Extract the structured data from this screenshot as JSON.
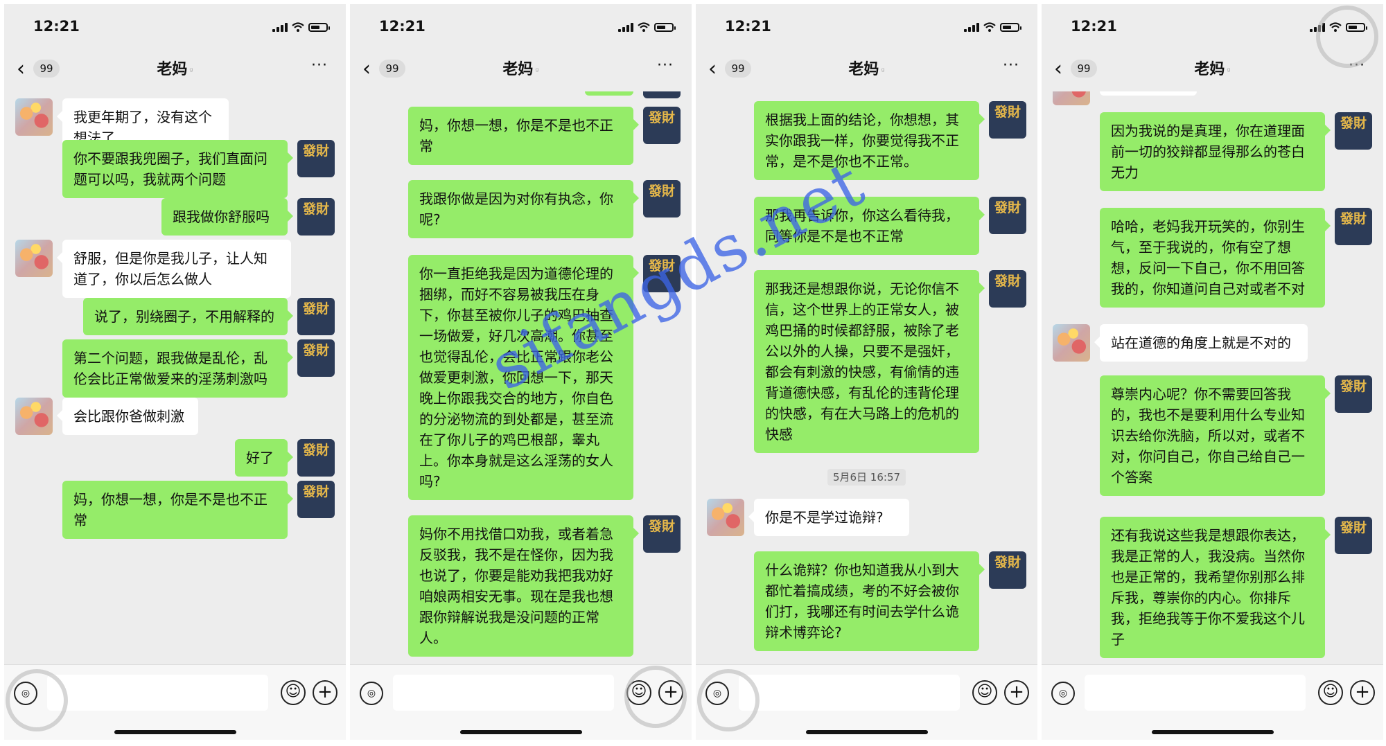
{
  "status": {
    "time": "12:21"
  },
  "nav": {
    "unread": "99",
    "title": "老妈",
    "more": "···",
    "back": "‹"
  },
  "avatar_label": "發財",
  "watermark": "sifangds.net",
  "panels": [
    {
      "messages": [
        {
          "side": "in",
          "text": "我更年期了，没有这个想法了"
        },
        {
          "side": "out",
          "text": "你不要跟我兜圈子，我们直面问题可以吗，我就两个问题"
        },
        {
          "side": "out",
          "text": "跟我做你舒服吗"
        },
        {
          "side": "in",
          "text": "舒服，但是你是我儿子，让人知道了，你以后怎么做人"
        },
        {
          "side": "out",
          "text": "说了，别绕圈子，不用解释的"
        },
        {
          "side": "out",
          "text": "第二个问题，跟我做是乱伦，乱伦会比正常做爱来的淫荡刺激吗"
        },
        {
          "side": "in",
          "text": "会比跟你爸做刺激"
        },
        {
          "side": "out",
          "text": "好了"
        },
        {
          "side": "out",
          "text": "妈，你想一想，你是不是也不正常"
        }
      ]
    },
    {
      "messages": [
        {
          "side": "out",
          "text": "妈，你想一想，你是不是也不正常"
        },
        {
          "side": "out",
          "text": "我跟你做是因为对你有执念，你呢?"
        },
        {
          "side": "out",
          "text": "你一直拒绝我是因为道德伦理的捆绑，而好不容易被我压在身下，你甚至被你儿子的鸡巴抽查一场做爱，好几次高潮。你甚至也觉得乱伦，会比正常跟你老公做爱更刺激，你回想一下，那天晚上你跟我交合的地方，你自色的分泌物流的到处都是，甚至流在了你儿子的鸡巴根部，睾丸上。你本身就是这么淫荡的女人吗?"
        },
        {
          "side": "out",
          "text": "妈你不用找借口劝我，或者着急反驳我，我不是在怪你，因为我也说了，你要是能劝我把我劝好咱娘两相安无事。现在是我也想跟你辩解说我是没问题的正常人。"
        }
      ]
    },
    {
      "messages": [
        {
          "side": "out",
          "text": "根据我上面的结论，你想想，其实你跟我一样，你要觉得我不正常，是不是你也不正常。"
        },
        {
          "side": "out",
          "text": "那我再告诉你，你这么看待我，同等你是不是也不正常"
        },
        {
          "side": "out",
          "text": "那我还是想跟你说，无论你信不信，这个世界上的正常女人，被鸡巴捅的时候都舒服，被除了老公以外的人操，只要不是强奸，都会有刺激的快感，有偷情的违背道德快感，有乱伦的违背伦理的快感，有在大马路上的危机的快感"
        },
        {
          "side": "time",
          "text": "5月6日 16:57"
        },
        {
          "side": "in",
          "text": "你是不是学过诡辩?"
        },
        {
          "side": "out",
          "text": "什么诡辩？你也知道我从小到大都忙着搞成绩，考的不好会被你们打，我哪还有时间去学什么诡辩术博弈论?"
        }
      ]
    },
    {
      "messages": [
        {
          "side": "out",
          "text": "因为我说的是真理，你在道理面前一切的狡辩都显得那么的苍白无力"
        },
        {
          "side": "out",
          "text": "哈哈，老妈我开玩笑的，你别生气，至于我说的，你有空了想想，反问一下自己，你不用回答我的，你知道问自己对或者不对"
        },
        {
          "side": "in",
          "text": "站在道德的角度上就是不对的"
        },
        {
          "side": "out",
          "text": "尊崇内心呢？你不需要回答我的，我也不是要利用什么专业知识去给你洗脑，所以对，或者不对，你问自己，你自己给自己一个答案"
        },
        {
          "side": "out",
          "text": "还有我说这些我是想跟你表达，我是正常的人，我没病。当然你也是正常的，我希望你别那么排斥我，尊崇你的内心。你排斥我，拒绝我等于你不爱我这个儿子"
        }
      ]
    }
  ]
}
